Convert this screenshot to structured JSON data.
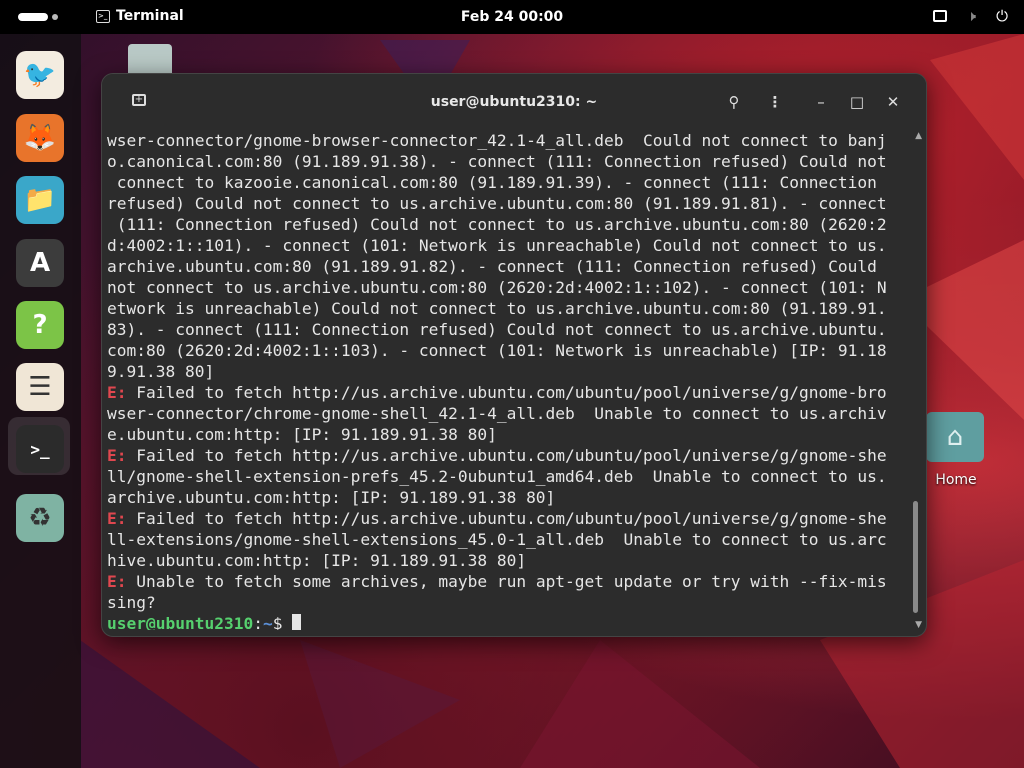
{
  "topbar": {
    "app_name": "Terminal",
    "clock": "Feb 24  00:00"
  },
  "dock": {
    "items": [
      {
        "name": "Thunderbird",
        "icon": "thunderbird-icon",
        "color": "#f3ece0"
      },
      {
        "name": "Firefox",
        "icon": "firefox-icon",
        "color": "#e8742b"
      },
      {
        "name": "Files",
        "icon": "files-icon",
        "color": "#3aa7c9"
      },
      {
        "name": "App Center",
        "icon": "app-center-icon",
        "color": "#3c3c3c"
      },
      {
        "name": "Help",
        "icon": "help-icon",
        "color": "#7cc447"
      },
      {
        "name": "Settings",
        "icon": "settings-icon",
        "color": "#f0e6d6"
      },
      {
        "name": "Terminal",
        "icon": "terminal-icon",
        "color": "#2b2b2b"
      },
      {
        "name": "Trash",
        "icon": "trash-icon",
        "color": "#7fb3a3"
      }
    ]
  },
  "desktop": {
    "home_label": "Home"
  },
  "terminal": {
    "title": "user@ubuntu2310: ~",
    "lines": [
      {
        "parts": [
          {
            "t": "wser-connector/gnome-browser-connector_42.1-4_all.deb  Could not connect to banj"
          }
        ]
      },
      {
        "parts": [
          {
            "t": "o.canonical.com:80 (91.189.91.38). - connect (111: Connection refused) Could not"
          }
        ]
      },
      {
        "parts": [
          {
            "t": " connect to kazooie.canonical.com:80 (91.189.91.39). - connect (111: Connection"
          }
        ]
      },
      {
        "parts": [
          {
            "t": "refused) Could not connect to us.archive.ubuntu.com:80 (91.189.91.81). - connect"
          }
        ]
      },
      {
        "parts": [
          {
            "t": " (111: Connection refused) Could not connect to us.archive.ubuntu.com:80 (2620:2"
          }
        ]
      },
      {
        "parts": [
          {
            "t": "d:4002:1::101). - connect (101: Network is unreachable) Could not connect to us."
          }
        ]
      },
      {
        "parts": [
          {
            "t": "archive.ubuntu.com:80 (91.189.91.82). - connect (111: Connection refused) Could"
          }
        ]
      },
      {
        "parts": [
          {
            "t": "not connect to us.archive.ubuntu.com:80 (2620:2d:4002:1::102). - connect (101: N"
          }
        ]
      },
      {
        "parts": [
          {
            "t": "etwork is unreachable) Could not connect to us.archive.ubuntu.com:80 (91.189.91."
          }
        ]
      },
      {
        "parts": [
          {
            "t": "83). - connect (111: Connection refused) Could not connect to us.archive.ubuntu."
          }
        ]
      },
      {
        "parts": [
          {
            "t": "com:80 (2620:2d:4002:1::103). - connect (101: Network is unreachable) [IP: 91.18"
          }
        ]
      },
      {
        "parts": [
          {
            "t": "9.91.38 80]"
          }
        ]
      },
      {
        "parts": [
          {
            "t": "E:",
            "c": "err"
          },
          {
            "t": " Failed to fetch http://us.archive.ubuntu.com/ubuntu/pool/universe/g/gnome-bro"
          }
        ]
      },
      {
        "parts": [
          {
            "t": "wser-connector/chrome-gnome-shell_42.1-4_all.deb  Unable to connect to us.archiv"
          }
        ]
      },
      {
        "parts": [
          {
            "t": "e.ubuntu.com:http: [IP: 91.189.91.38 80]"
          }
        ]
      },
      {
        "parts": [
          {
            "t": "E:",
            "c": "err"
          },
          {
            "t": " Failed to fetch http://us.archive.ubuntu.com/ubuntu/pool/universe/g/gnome-she"
          }
        ]
      },
      {
        "parts": [
          {
            "t": "ll/gnome-shell-extension-prefs_45.2-0ubuntu1_amd64.deb  Unable to connect to us."
          }
        ]
      },
      {
        "parts": [
          {
            "t": "archive.ubuntu.com:http: [IP: 91.189.91.38 80]"
          }
        ]
      },
      {
        "parts": [
          {
            "t": "E:",
            "c": "err"
          },
          {
            "t": " Failed to fetch http://us.archive.ubuntu.com/ubuntu/pool/universe/g/gnome-she"
          }
        ]
      },
      {
        "parts": [
          {
            "t": "ll-extensions/gnome-shell-extensions_45.0-1_all.deb  Unable to connect to us.arc"
          }
        ]
      },
      {
        "parts": [
          {
            "t": "hive.ubuntu.com:http: [IP: 91.189.91.38 80]"
          }
        ]
      },
      {
        "parts": [
          {
            "t": "E:",
            "c": "err"
          },
          {
            "t": " Unable to fetch some archives, maybe run apt-get update or try with --fix-mis"
          }
        ]
      },
      {
        "parts": [
          {
            "t": "sing?"
          }
        ]
      }
    ],
    "prompt_user": "user@ubuntu2310",
    "prompt_sep": ":",
    "prompt_path": "~",
    "prompt_symbol": "$ "
  }
}
